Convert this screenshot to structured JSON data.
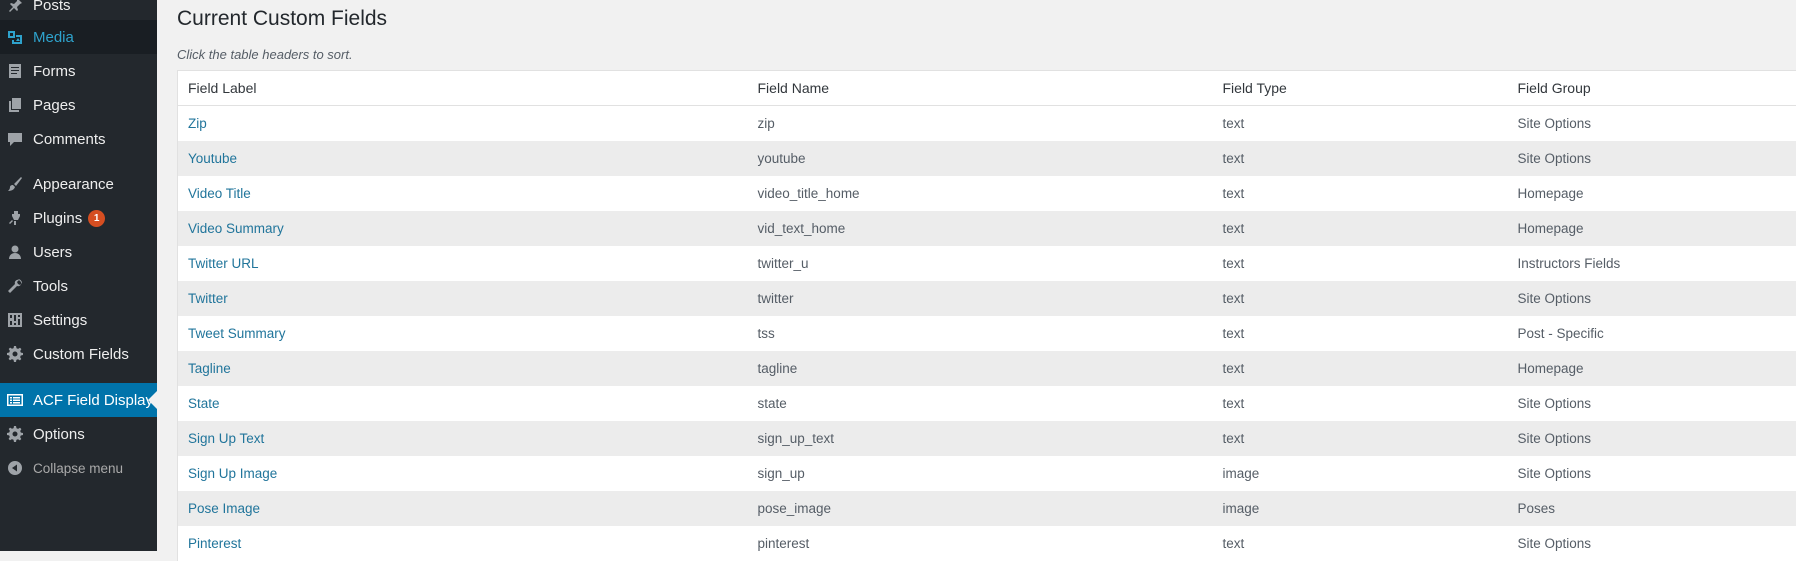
{
  "sidebar": {
    "items": [
      {
        "label": "Posts",
        "icon": "pushpin-icon"
      },
      {
        "label": "Media",
        "icon": "media-icon"
      },
      {
        "label": "Forms",
        "icon": "forms-icon"
      },
      {
        "label": "Pages",
        "icon": "pages-icon"
      },
      {
        "label": "Comments",
        "icon": "comments-icon"
      },
      {
        "label": "Appearance",
        "icon": "paintbrush-icon"
      },
      {
        "label": "Plugins",
        "icon": "plugin-icon",
        "badge": "1"
      },
      {
        "label": "Users",
        "icon": "users-icon"
      },
      {
        "label": "Tools",
        "icon": "wrench-icon"
      },
      {
        "label": "Settings",
        "icon": "settings-icon"
      },
      {
        "label": "Custom Fields",
        "icon": "gear-icon"
      },
      {
        "label": "ACF Field Display",
        "icon": "list-view-icon"
      },
      {
        "label": "Options",
        "icon": "gear-icon"
      },
      {
        "label": "Collapse menu",
        "icon": "collapse-arrow-icon"
      }
    ]
  },
  "main": {
    "title": "Current Custom Fields",
    "hint": "Click the table headers to sort.",
    "columns": [
      "Field Label",
      "Field Name",
      "Field Type",
      "Field Group"
    ],
    "rows": [
      [
        "Zip",
        "zip",
        "text",
        "Site Options"
      ],
      [
        "Youtube",
        "youtube",
        "text",
        "Site Options"
      ],
      [
        "Video Title",
        "video_title_home",
        "text",
        "Homepage"
      ],
      [
        "Video Summary",
        "vid_text_home",
        "text",
        "Homepage"
      ],
      [
        "Twitter URL",
        "twitter_u",
        "text",
        "Instructors Fields"
      ],
      [
        "Twitter",
        "twitter",
        "text",
        "Site Options"
      ],
      [
        "Tweet Summary",
        "tss",
        "text",
        "Post - Specific"
      ],
      [
        "Tagline",
        "tagline",
        "text",
        "Homepage"
      ],
      [
        "State",
        "state",
        "text",
        "Site Options"
      ],
      [
        "Sign Up Text",
        "sign_up_text",
        "text",
        "Site Options"
      ],
      [
        "Sign Up Image",
        "sign_up",
        "image",
        "Site Options"
      ],
      [
        "Pose Image",
        "pose_image",
        "image",
        "Poses"
      ],
      [
        "Pinterest",
        "pinterest",
        "text",
        "Site Options"
      ]
    ]
  },
  "colors": {
    "sidebar_bg": "#23282d",
    "active_menu_bg": "#0073aa",
    "link": "#21759b",
    "badge": "#d54e21"
  }
}
